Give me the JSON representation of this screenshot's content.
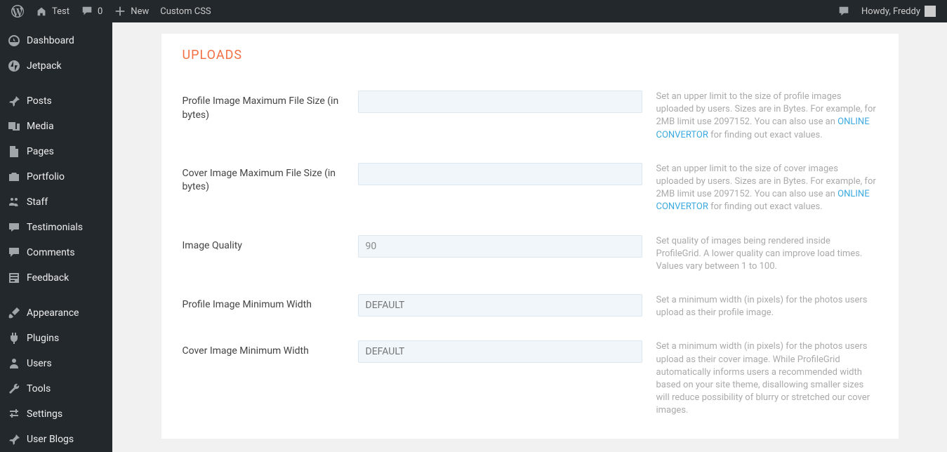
{
  "adminbar": {
    "site_name": "Test",
    "comments": "0",
    "new": "New",
    "custom_css": "Custom CSS",
    "howdy_prefix": "Howdy, ",
    "howdy_user": "Freddy"
  },
  "sidebar": {
    "items": [
      {
        "label": "Dashboard"
      },
      {
        "label": "Jetpack"
      },
      {
        "label": "Posts"
      },
      {
        "label": "Media"
      },
      {
        "label": "Pages"
      },
      {
        "label": "Portfolio"
      },
      {
        "label": "Staff"
      },
      {
        "label": "Testimonials"
      },
      {
        "label": "Comments"
      },
      {
        "label": "Feedback"
      },
      {
        "label": "Appearance"
      },
      {
        "label": "Plugins"
      },
      {
        "label": "Users"
      },
      {
        "label": "Tools"
      },
      {
        "label": "Settings"
      },
      {
        "label": "User Blogs"
      }
    ]
  },
  "page": {
    "title": "UPLOADS",
    "fields": {
      "profile_max_size": {
        "label": "Profile Image Maximum File Size (in bytes)",
        "value": "",
        "help_pre": "Set an upper limit to the size of profile images uploaded by users. Sizes are in Bytes. For example, for 2MB limit use 2097152. You can also use an ",
        "help_link": "ONLINE CONVERTOR",
        "help_post": " for finding out exact values."
      },
      "cover_max_size": {
        "label": "Cover Image Maximum File Size (in bytes)",
        "value": "",
        "help_pre": "Set an upper limit to the size of cover images uploaded by users. Sizes are in Bytes. For example, for 2MB limit use 2097152. You can also use an ",
        "help_link": "ONLINE CONVERTOR",
        "help_post": " for finding out exact values."
      },
      "image_quality": {
        "label": "Image Quality",
        "value": "90",
        "help": "Set quality of images being rendered inside ProfileGrid. A lower quality can improve load times. Values vary between 1 to 100."
      },
      "profile_min_width": {
        "label": "Profile Image Minimum Width",
        "placeholder": "DEFAULT",
        "value": "",
        "help": "Set a minimum width (in pixels) for the photos users upload as their profile image."
      },
      "cover_min_width": {
        "label": "Cover Image Minimum Width",
        "placeholder": "DEFAULT",
        "value": "",
        "help": "Set a minimum width (in pixels) for the photos users upload as their cover image. While ProfileGrid automatically informs users a recommended width based on your site theme, disallowing smaller sizes will reduce possibility of blurry or stretched our cover images."
      }
    }
  }
}
